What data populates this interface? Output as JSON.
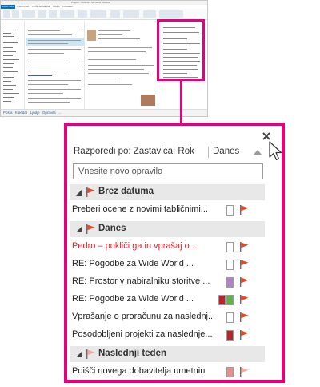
{
  "thumbnail": {
    "window_title": "Prejeto - Outlook - Microsoft Outlook",
    "file_tab": "DATOTEKA",
    "ribbon_tabs": [
      "OSNOVNO",
      "POŠLJI/PREJMI",
      "MAPA",
      "POGLED"
    ],
    "nav_items": [
      "Pošta",
      "Koledar",
      "Ljudje",
      "Opravila",
      "..."
    ]
  },
  "todo": {
    "close_icon": "close-icon",
    "arrange_label": "Razporedi po: Zastavica: Rok",
    "arrange_value": "Danes",
    "new_task_placeholder": "Vnesite novo opravilo",
    "groups": [
      {
        "label": "Brez datuma",
        "flag_color": "#e04b2b",
        "tasks": [
          {
            "subject": "Preberi ocene z novimi tabličnimi...",
            "red": false,
            "categories": [
              "#ffffff"
            ],
            "flag": "#e04b2b"
          }
        ]
      },
      {
        "label": "Danes",
        "flag_color": "#e04b2b",
        "tasks": [
          {
            "subject": "Pedro – pokliči ga in vprašaj o ...",
            "red": true,
            "categories": [
              "#ffffff"
            ],
            "flag": "#e04b2b"
          },
          {
            "subject": "RE: Pogodbe za Wide World ...",
            "red": false,
            "categories": [
              "#ffffff"
            ],
            "flag": "#e04b2b"
          },
          {
            "subject": "RE: Prostor v nabiralniku storitve ...",
            "red": false,
            "categories": [
              "#b383c9"
            ],
            "flag": "#e04b2b"
          },
          {
            "subject": "RE: Pogodbe za Wide World ...",
            "red": false,
            "categories": [
              "#b3262a",
              "#5fb344"
            ],
            "flag": "#e04b2b"
          },
          {
            "subject": "Vprašanje o proračunu za naslednj...",
            "red": false,
            "categories": [
              "#ffffff"
            ],
            "flag": "#e04b2b"
          },
          {
            "subject": "Posodobljeni projekti za naslednje...",
            "red": false,
            "categories": [
              "#b3262a"
            ],
            "flag": "#e04b2b"
          }
        ]
      },
      {
        "label": "Naslednji teden",
        "flag_color": "#f2a7a3",
        "tasks": [
          {
            "subject": "Poišči novega dobavitelja umetnin",
            "red": false,
            "categories": [
              "#e88d88"
            ],
            "flag": "#f2a7a3"
          }
        ]
      }
    ]
  },
  "colors": {
    "highlight": "#e6007e",
    "flag_today": "#e04b2b",
    "flag_next_week": "#f2a7a3",
    "group_header_bg": "#e8e8e8"
  }
}
